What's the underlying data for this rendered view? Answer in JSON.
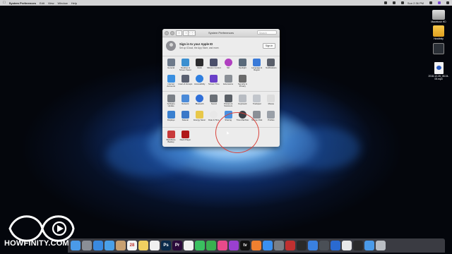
{
  "menubar": {
    "apple_icon": "apple-icon",
    "app_name": "System Preferences",
    "items": [
      "Edit",
      "View",
      "Window",
      "Help"
    ],
    "clock": "Sun 2:36 PM",
    "status_icons": [
      "wifi-icon",
      "volume-icon",
      "battery-icon",
      "spotlight-icon",
      "siri-icon",
      "notifications-icon"
    ]
  },
  "desktop_icons": [
    {
      "label": "Macintosh HD",
      "icon": "hard-drive-icon"
    },
    {
      "label": "Howfinity",
      "icon": "folder-icon"
    },
    {
      "label": "",
      "icon": "time-machine-drive-icon"
    },
    {
      "label": "2018-12-28_08-04-05.mp4",
      "icon": "video-file-icon"
    }
  ],
  "window": {
    "title": "System Preferences",
    "search_placeholder": "Search",
    "back_label": "‹",
    "forward_label": "›",
    "grid_label": "⋮⋮⋮",
    "signin": {
      "title": "Sign in to your Apple ID",
      "subtitle": "Set up iCloud, the App Store, and more.",
      "button": "Sign In"
    },
    "rows": [
      [
        {
          "label": "General",
          "color": "#6e7a8a",
          "icon": "general-icon"
        },
        {
          "label": "Desktop & Screen Saver",
          "color": "#3a8fd0",
          "icon": "desktop-icon"
        },
        {
          "label": "Dock",
          "color": "#2c2c2e",
          "icon": "dock-icon"
        },
        {
          "label": "Mission Control",
          "color": "#4a4f6a",
          "icon": "mission-control-icon"
        },
        {
          "label": "Siri",
          "color": "#b040c0",
          "icon": "siri-icon"
        },
        {
          "label": "Spotlight",
          "color": "#5a6a7a",
          "icon": "spotlight-icon"
        },
        {
          "label": "Language & Region",
          "color": "#3a7ad8",
          "icon": "language-icon"
        },
        {
          "label": "Notifications",
          "color": "#5a5f6a",
          "icon": "notifications-icon"
        }
      ],
      [
        {
          "label": "Internet Accounts",
          "color": "#3a8fe0",
          "icon": "internet-accounts-icon"
        },
        {
          "label": "Users & Groups",
          "color": "#5a6070",
          "icon": "users-icon"
        },
        {
          "label": "Accessibility",
          "color": "#2f7fe0",
          "icon": "accessibility-icon"
        },
        {
          "label": "Screen Time",
          "color": "#6a40c8",
          "icon": "screen-time-icon"
        },
        {
          "label": "Extensions",
          "color": "#8a8f96",
          "icon": "extensions-icon"
        },
        {
          "label": "Security & Privacy",
          "color": "#6a6a6a",
          "icon": "security-icon"
        }
      ],
      [
        {
          "label": "Software Update",
          "color": "#7a7f86",
          "icon": "software-update-icon"
        },
        {
          "label": "Network",
          "color": "#4a8ad8",
          "icon": "network-icon"
        },
        {
          "label": "Bluetooth",
          "color": "#2f6fd8",
          "icon": "bluetooth-icon"
        },
        {
          "label": "Sound",
          "color": "#6a6f76",
          "icon": "sound-icon"
        },
        {
          "label": "Printers & Scanners",
          "color": "#5a5f66",
          "icon": "printer-icon"
        },
        {
          "label": "Keyboard",
          "color": "#b8bcc2",
          "icon": "keyboard-icon"
        },
        {
          "label": "Trackpad",
          "color": "#c2c6cc",
          "icon": "trackpad-icon"
        },
        {
          "label": "Mouse",
          "color": "#dcdcdc",
          "icon": "mouse-icon"
        }
      ],
      [
        {
          "label": "Displays",
          "color": "#3a80d0",
          "icon": "displays-icon"
        },
        {
          "label": "Sidecar",
          "color": "#3a78c8",
          "icon": "sidecar-icon"
        },
        {
          "label": "Energy Saver",
          "color": "#e8c84a",
          "icon": "energy-saver-icon"
        },
        {
          "label": "Date & Time",
          "color": "#e8e8e8",
          "icon": "clock-icon"
        },
        {
          "label": "Sharing",
          "color": "#4a90e0",
          "icon": "sharing-icon"
        },
        {
          "label": "Time Machine",
          "color": "#3a3f46",
          "icon": "time-machine-icon"
        },
        {
          "label": "Startup Disk",
          "color": "#8a8f96",
          "icon": "startup-disk-icon"
        },
        {
          "label": "Profiles",
          "color": "#9aa0a8",
          "icon": "profiles-icon"
        }
      ],
      [
        {
          "label": "Backblaze Backup",
          "color": "#c83a3a",
          "icon": "backblaze-icon"
        },
        {
          "label": "Flash Player",
          "color": "#b01818",
          "icon": "flash-player-icon"
        }
      ]
    ]
  },
  "logo": {
    "text": "HOWFINITY.COM"
  },
  "dock": [
    {
      "name": "finder",
      "color": "#4a9ae8",
      "glyph": ""
    },
    {
      "name": "launchpad",
      "color": "#8a8f96",
      "glyph": ""
    },
    {
      "name": "safari",
      "color": "#3a8ae0",
      "glyph": ""
    },
    {
      "name": "mail",
      "color": "#4aa0e8",
      "glyph": ""
    },
    {
      "name": "contacts",
      "color": "#c8a070",
      "glyph": ""
    },
    {
      "name": "calendar",
      "color": "#f4f4f4",
      "glyph": "28"
    },
    {
      "name": "notes",
      "color": "#f0d060",
      "glyph": ""
    },
    {
      "name": "reminders",
      "color": "#f0f0f0",
      "glyph": ""
    },
    {
      "name": "photoshop",
      "color": "#0a2a4a",
      "glyph": "Ps"
    },
    {
      "name": "premiere",
      "color": "#2a0a3a",
      "glyph": "Pr"
    },
    {
      "name": "photos",
      "color": "#f0f0f0",
      "glyph": ""
    },
    {
      "name": "messages",
      "color": "#3ac060",
      "glyph": ""
    },
    {
      "name": "facetime",
      "color": "#3ab050",
      "glyph": ""
    },
    {
      "name": "itunes",
      "color": "#e84a8a",
      "glyph": ""
    },
    {
      "name": "podcasts",
      "color": "#9a40d0",
      "glyph": ""
    },
    {
      "name": "tv",
      "color": "#111111",
      "glyph": "tv"
    },
    {
      "name": "books",
      "color": "#f08030",
      "glyph": ""
    },
    {
      "name": "app-store",
      "color": "#3a90f0",
      "glyph": ""
    },
    {
      "name": "system-preferences",
      "color": "#7a7f86",
      "glyph": ""
    },
    {
      "name": "screenflow",
      "color": "#c03030",
      "glyph": ""
    },
    {
      "name": "terminal",
      "color": "#2a2a2a",
      "glyph": ""
    },
    {
      "name": "keynote",
      "color": "#3a80e0",
      "glyph": ""
    },
    {
      "name": "camera-app",
      "color": "#4a4f56",
      "glyph": ""
    },
    {
      "name": "1password",
      "color": "#2a6ad0",
      "glyph": ""
    },
    {
      "name": "chrome",
      "color": "#e8e8e8",
      "glyph": ""
    },
    {
      "name": "obs",
      "color": "#2a2a2a",
      "glyph": ""
    },
    {
      "name": "folder",
      "color": "#4a9ae8",
      "glyph": ""
    },
    {
      "name": "trash",
      "color": "#b8bcc2",
      "glyph": ""
    }
  ]
}
